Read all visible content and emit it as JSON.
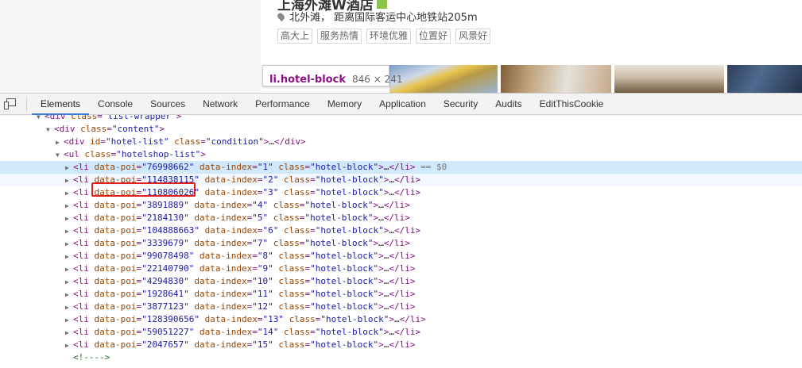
{
  "hotel": {
    "title": "上海外滩W酒店",
    "address": "北外滩， 距离国际客运中心地铁站205m",
    "tags": [
      "高大上",
      "服务热情",
      "环境优雅",
      "位置好",
      "风景好"
    ]
  },
  "tooltip": {
    "tag": "li.hotel-block",
    "size": "846 × 241"
  },
  "devtools": {
    "tabs": [
      "Elements",
      "Console",
      "Sources",
      "Network",
      "Performance",
      "Memory",
      "Application",
      "Security",
      "Audits",
      "EditThisCookie"
    ],
    "active_tab": "Elements",
    "selected_suffix": " == $0",
    "lines": {
      "l0": {
        "tag": "div",
        "attr": "class",
        "val": "\"list-wrapper\""
      },
      "l1": {
        "tag": "div",
        "attr": "class",
        "val": "\"content\""
      },
      "l2": {
        "tag": "div",
        "a1": "id",
        "v1": "\"hotel-list\"",
        "a2": "class",
        "v2": "\"condition\"",
        "tail": "…",
        "close": "</div>"
      },
      "l3": {
        "tag": "ul",
        "attr": "class",
        "val": "\"hotelshop-list\""
      },
      "comment": "<!---->"
    },
    "items": [
      {
        "poi": "\"76998662\"",
        "index": "\"1\""
      },
      {
        "poi": "\"114838115\"",
        "index": "\"2\""
      },
      {
        "poi": "\"110806026\"",
        "index": "\"3\""
      },
      {
        "poi": "\"3891889\"",
        "index": "\"4\""
      },
      {
        "poi": "\"2184130\"",
        "index": "\"5\""
      },
      {
        "poi": "\"104888663\"",
        "index": "\"6\""
      },
      {
        "poi": "\"3339679\"",
        "index": "\"7\""
      },
      {
        "poi": "\"99078498\"",
        "index": "\"8\""
      },
      {
        "poi": "\"22140790\"",
        "index": "\"9\""
      },
      {
        "poi": "\"4294830\"",
        "index": "\"10\""
      },
      {
        "poi": "\"1928641\"",
        "index": "\"11\""
      },
      {
        "poi": "\"3877123\"",
        "index": "\"12\""
      },
      {
        "poi": "\"128390656\"",
        "index": "\"13\""
      },
      {
        "poi": "\"59051227\"",
        "index": "\"14\""
      },
      {
        "poi": "\"2047657\"",
        "index": "\"15\""
      }
    ],
    "item_tag": "li",
    "item_attr_poi": "data-poi",
    "item_attr_index": "data-index",
    "item_attr_class": "class",
    "item_class_val": "\"hotel-block\"",
    "item_tail": "…",
    "item_close": "</li>"
  },
  "colors": {
    "selected_row": "#cfe8fc",
    "highlight_border": "#e0201c",
    "tab_active_underline": "#3879d9"
  }
}
